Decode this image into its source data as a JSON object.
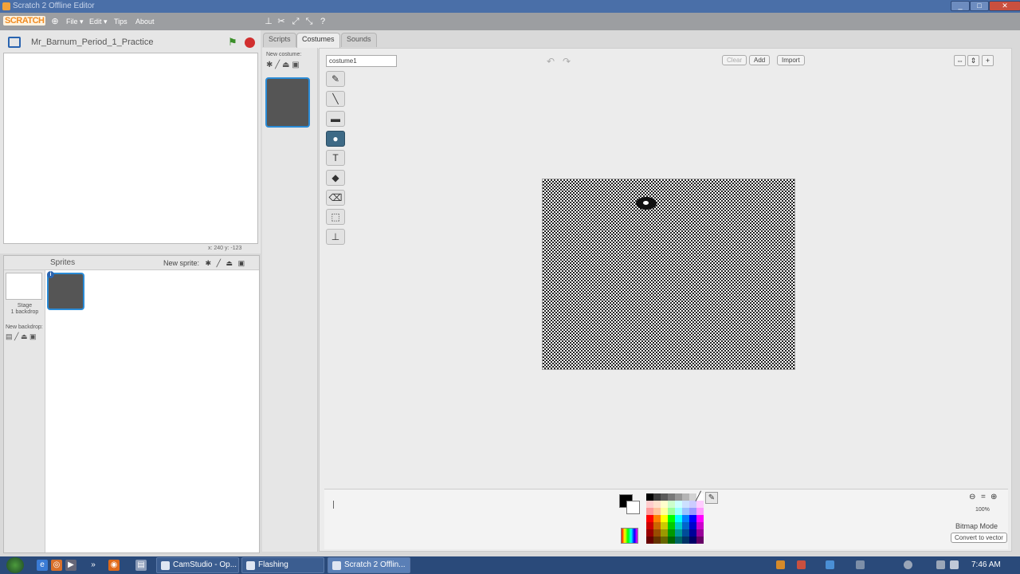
{
  "window": {
    "title": "Scratch 2 Offline Editor",
    "controls": {
      "minimize": "_",
      "maximize": "□",
      "close": "✕"
    }
  },
  "menubar": {
    "logo": "SCRATCH",
    "items": [
      {
        "name": "globe-icon",
        "label": ""
      },
      {
        "name": "file-menu",
        "label": "File ▾"
      },
      {
        "name": "edit-menu",
        "label": "Edit ▾"
      },
      {
        "name": "tips-menu",
        "label": "Tips"
      },
      {
        "name": "about-menu",
        "label": "About"
      }
    ],
    "tools": [
      "duplicate-icon",
      "cut-icon",
      "grow-icon",
      "shrink-icon",
      "help-icon"
    ]
  },
  "stage": {
    "project_name": "Mr_Barnum_Period_1_Practice",
    "coords": "x: 240  y: -123"
  },
  "sprites": {
    "header": "Sprites",
    "new_sprite": "New sprite:",
    "stage_label_1": "Stage",
    "stage_label_2": "1 backdrop",
    "new_backdrop": "New backdrop:",
    "info": "i"
  },
  "tabs": [
    {
      "name": "tab-scripts",
      "label": "Scripts",
      "active": false
    },
    {
      "name": "tab-costumes",
      "label": "Costumes",
      "active": true
    },
    {
      "name": "tab-sounds",
      "label": "Sounds",
      "active": false
    }
  ],
  "costumes": {
    "new_costume": "New costume:",
    "current_name": "costume1"
  },
  "editor": {
    "clear": "Clear",
    "add": "Add",
    "import": "Import",
    "undo": "↶",
    "redo": "↷",
    "tools": [
      {
        "name": "brush-tool",
        "glyph": "✎",
        "active": false
      },
      {
        "name": "line-tool",
        "glyph": "╲",
        "active": false
      },
      {
        "name": "rectangle-tool",
        "glyph": "▬",
        "active": false
      },
      {
        "name": "ellipse-tool",
        "glyph": "●",
        "active": true
      },
      {
        "name": "text-tool",
        "glyph": "T",
        "active": false
      },
      {
        "name": "fill-tool",
        "glyph": "◆",
        "active": false
      },
      {
        "name": "eraser-tool",
        "glyph": "⌫",
        "active": false
      },
      {
        "name": "select-tool",
        "glyph": "⬚",
        "active": false
      },
      {
        "name": "stamp-tool",
        "glyph": "⊥",
        "active": false
      }
    ],
    "zoom_percent": "100%",
    "mode": "Bitmap Mode",
    "convert": "Convert to vector",
    "palette": [
      "#000000",
      "#3c3c3c",
      "#5a5a5a",
      "#787878",
      "#969696",
      "#b4b4b4",
      "#d2d2d2",
      "#ffffff",
      "#ffcccc",
      "#ffe0cc",
      "#ffffcc",
      "#ccffcc",
      "#ccffff",
      "#cce0ff",
      "#ccccff",
      "#ffccff",
      "#ff9999",
      "#ffc299",
      "#ffff99",
      "#99ff99",
      "#99ffff",
      "#99c2ff",
      "#9999ff",
      "#ff99ff",
      "#ff0000",
      "#ff8000",
      "#ffff00",
      "#00ff00",
      "#00ffff",
      "#0080ff",
      "#0000ff",
      "#ff00ff",
      "#cc0000",
      "#cc6600",
      "#cccc00",
      "#00cc00",
      "#00cccc",
      "#0066cc",
      "#0000cc",
      "#cc00cc",
      "#990000",
      "#994c00",
      "#999900",
      "#009900",
      "#009999",
      "#004c99",
      "#000099",
      "#990099",
      "#660000",
      "#663300",
      "#666600",
      "#006600",
      "#006666",
      "#003366",
      "#000066",
      "#660066"
    ]
  },
  "taskbar": {
    "tasks": [
      {
        "name": "task-camstudio",
        "label": "CamStudio - Op...",
        "active": false
      },
      {
        "name": "task-flashing",
        "label": "Flashing",
        "active": false
      },
      {
        "name": "task-scratch",
        "label": "Scratch 2 Offlin...",
        "active": true
      }
    ],
    "clock": "7:46 AM"
  }
}
